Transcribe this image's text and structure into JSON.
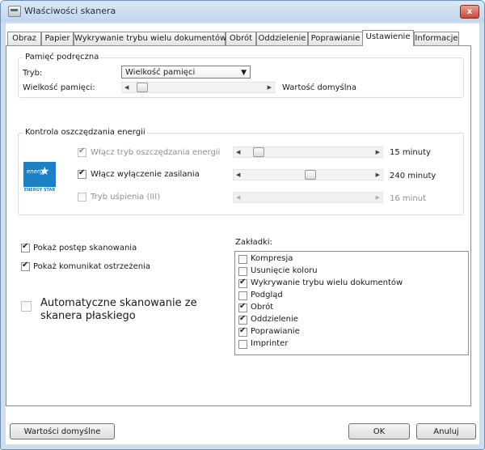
{
  "window": {
    "title": "Właściwości skanera",
    "close": "x"
  },
  "tabs": [
    {
      "label": "Obraz"
    },
    {
      "label": "Papier"
    },
    {
      "label": "Wykrywanie trybu wielu dokumentów"
    },
    {
      "label": "Obrót"
    },
    {
      "label": "Oddzielenie"
    },
    {
      "label": "Poprawianie"
    },
    {
      "label": "Ustawienie"
    },
    {
      "label": "Informacje"
    }
  ],
  "active_tab": "Ustawienie",
  "cache": {
    "group_label": "Pamięć podręczna",
    "mode_label": "Tryb:",
    "mode_value": "Wielkość pamięci",
    "size_label": "Wielkość pamięci:",
    "size_value": "Wartość domyślna"
  },
  "energy": {
    "group_label": "Kontrola oszczędzania energii",
    "logo_text": "energy",
    "logo_caption": "ENERGY STAR",
    "rows": [
      {
        "label": "Włącz tryb oszczędzania energii",
        "value": "15 minuty",
        "checked": true,
        "enabled": false
      },
      {
        "label": "Włącz wyłączenie zasilania",
        "value": "240 minuty",
        "checked": true,
        "enabled": true
      },
      {
        "label": "Tryb uśpienia (III)",
        "value": "16 minut",
        "checked": false,
        "enabled": false
      }
    ]
  },
  "options": {
    "show_progress": "Pokaż postęp skanowania",
    "show_warning": "Pokaż komunikat ostrzeżenia",
    "auto_flatbed": "Automatyczne skanowanie ze skanera płaskiego"
  },
  "bookmarks": {
    "label": "Zakładki:",
    "items": [
      {
        "label": "Kompresja",
        "checked": false
      },
      {
        "label": "Usunięcie koloru",
        "checked": false
      },
      {
        "label": "Wykrywanie trybu wielu dokumentów",
        "checked": true
      },
      {
        "label": "Podgląd",
        "checked": false
      },
      {
        "label": "Obrót",
        "checked": true
      },
      {
        "label": "Oddzielenie",
        "checked": true
      },
      {
        "label": "Poprawianie",
        "checked": true
      },
      {
        "label": "Imprinter",
        "checked": false
      }
    ]
  },
  "buttons": {
    "defaults": "Wartości domyślne",
    "ok": "OK",
    "cancel": "Anuluj"
  },
  "icons": {
    "arrow_left": "◀",
    "arrow_right": "▶",
    "dropdown": "▼"
  }
}
